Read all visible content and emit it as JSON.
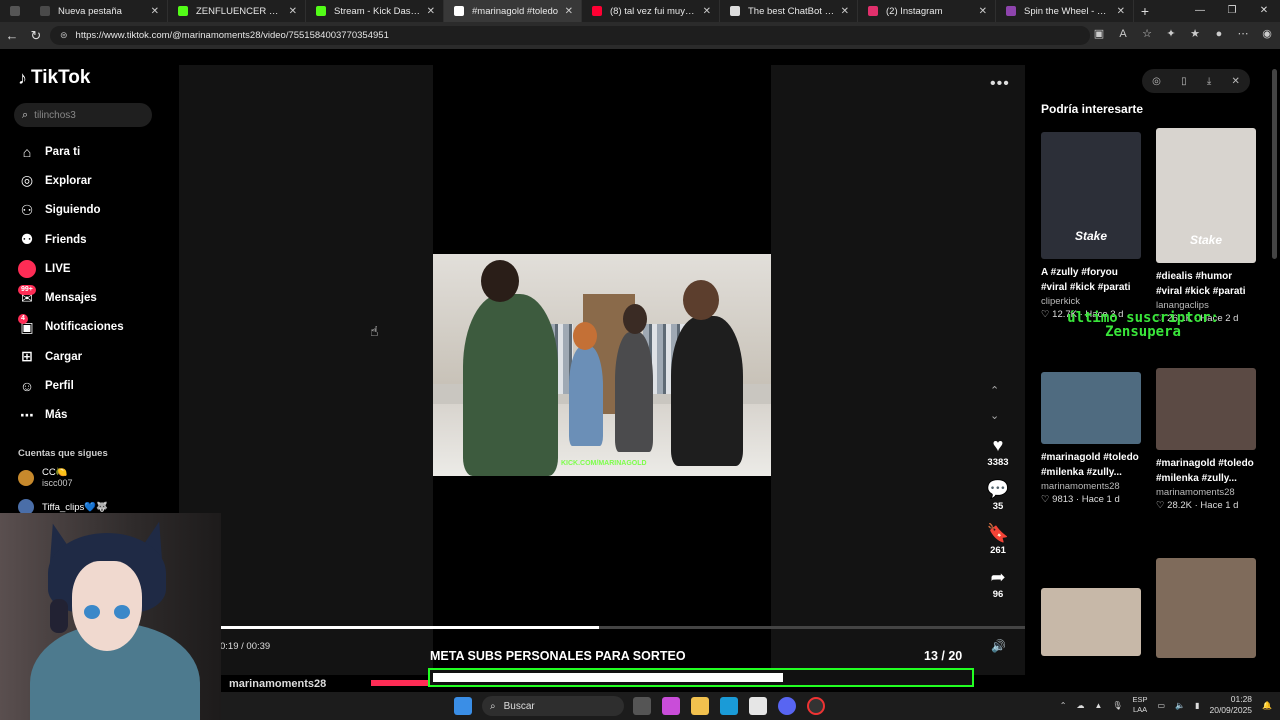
{
  "browser": {
    "tabs": [
      {
        "title": "Nueva pestaña",
        "color": "#4a4a4a"
      },
      {
        "title": "ZENFLUENCER Stream - Wa",
        "color": "#53fc18"
      },
      {
        "title": "Stream - Kick Dashboard",
        "color": "#53fc18"
      },
      {
        "title": "#marinagold #toledo",
        "color": "#ffffff",
        "active": true
      },
      {
        "title": "(8) tal vez fui muy duro con",
        "color": "#ff0033"
      },
      {
        "title": "The best ChatBot and Widg",
        "color": "#dddddd"
      },
      {
        "title": "(2) Instagram",
        "color": "#e1306c"
      },
      {
        "title": "Spin the Wheel - Free and",
        "color": "#8e44ad"
      }
    ],
    "new_tab": "+",
    "url": "https://www.tiktok.com/@marinamoments28/video/7551584003770354951"
  },
  "tiktok": {
    "logo": "TikTok",
    "search_placeholder": "tilinchos3",
    "nav": [
      {
        "label": "Para ti",
        "icon": "home-icon"
      },
      {
        "label": "Explorar",
        "icon": "compass-icon"
      },
      {
        "label": "Siguiendo",
        "icon": "following-icon"
      },
      {
        "label": "Friends",
        "icon": "friends-icon"
      },
      {
        "label": "LIVE",
        "icon": "live-icon"
      },
      {
        "label": "Mensajes",
        "icon": "messages-icon",
        "badge": "99+"
      },
      {
        "label": "Notificaciones",
        "icon": "notifications-icon",
        "badge": "4"
      },
      {
        "label": "Cargar",
        "icon": "upload-icon"
      },
      {
        "label": "Perfil",
        "icon": "profile-icon"
      },
      {
        "label": "Más",
        "icon": "more-icon"
      }
    ],
    "following_title": "Cuentas que sigues",
    "following": [
      {
        "name": "CC🍋",
        "handle": "iscc007"
      },
      {
        "name": "Tiffa_clips💙🐺",
        "handle": ""
      }
    ]
  },
  "video": {
    "watermark": "KICK.COM/MARINAGOLD",
    "likes": "3383",
    "comments": "35",
    "saves": "261",
    "shares": "96",
    "time": "0:19 / 00:39",
    "progress": 0.47,
    "author": "marinamoments28"
  },
  "goal": {
    "title": "META SUBS PERSONALES PARA SORTEO",
    "current": "13",
    "total": "/ 20",
    "fraction": 0.65
  },
  "recommendations": {
    "title": "Podría interesarte",
    "cards": [
      {
        "caption": "A #zully #foryou #viral #kick #parati",
        "author": "cliperkick",
        "stats": "♡ 12.7K · Hace 3 d",
        "overlay": "Stake",
        "bg": "#2c2f38"
      },
      {
        "caption": "#diealis #humor #viral #kick #parati",
        "author": "lanangaclips",
        "stats": "♡ 26.1K · Hace 2 d",
        "overlay": "Stake",
        "bg": "#d8d4cf"
      },
      {
        "caption": "#marinagold #toledo #milenka #zully...",
        "author": "marinamoments28",
        "stats": "♡ 9813 · Hace 1 d",
        "overlay": "",
        "bg": "#4f6b80"
      },
      {
        "caption": "#marinagold #toledo #milenka #zully...",
        "author": "marinamoments28",
        "stats": "♡ 28.2K · Hace 1 d",
        "overlay": "",
        "bg": "#5b4a44"
      },
      {
        "caption": "",
        "author": "",
        "stats": "",
        "overlay": "",
        "bg": "#c7b8a8"
      },
      {
        "caption": "",
        "author": "",
        "stats": "",
        "overlay": "",
        "bg": "#7f6b5b"
      }
    ]
  },
  "stream_overlay": {
    "line1": "último suscriptor:",
    "line2": "Zensupera"
  },
  "taskbar": {
    "search": "Buscar",
    "lang_top": "ESP",
    "lang_bottom": "LAA",
    "time": "01:28",
    "date": "20/09/2025"
  }
}
